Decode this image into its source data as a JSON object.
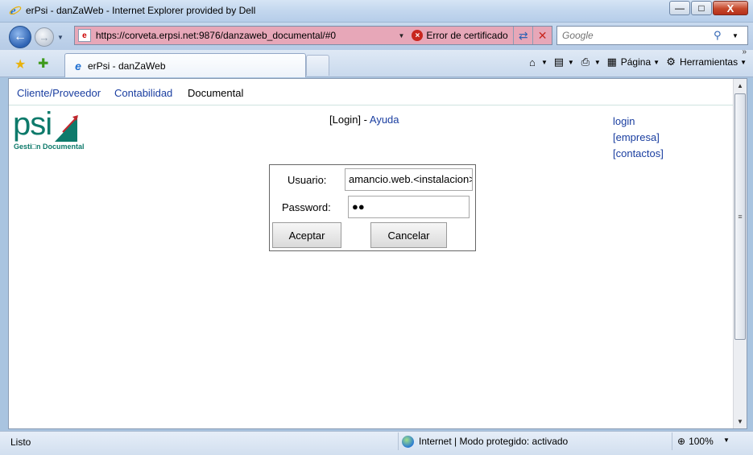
{
  "window": {
    "title": "erPsi - danZaWeb - Internet Explorer provided by Dell",
    "close_glyph": "X",
    "max_glyph": "□",
    "min_glyph": "—"
  },
  "address": {
    "url": "https://corveta.erpsi.net:9876/danzaweb_documental/#0",
    "cert_error": "Error de certificado",
    "search_placeholder": "Google"
  },
  "tabs": {
    "active_label": "erPsi - danZaWeb"
  },
  "commandbar": {
    "page_label": "Página",
    "tools_label": "Herramientas"
  },
  "menu": {
    "items": [
      "Cliente/Proveedor",
      "Contabilidad",
      "Documental"
    ]
  },
  "logo": {
    "text": "psi",
    "subtitle": "Gesti□n Documental"
  },
  "header_links": {
    "login_bracket": "[Login]",
    "separator": " - ",
    "help": "Ayuda"
  },
  "side_links": {
    "items": [
      "login",
      "[empresa]",
      "[contactos]"
    ]
  },
  "login_form": {
    "user_label": "Usuario:",
    "user_value": "amancio.web.<instalacion>",
    "password_label": "Password:",
    "password_value": "●●",
    "accept_label": "Aceptar",
    "cancel_label": "Cancelar"
  },
  "status": {
    "text": "Listo",
    "zone": "Internet | Modo protegido: activado",
    "zoom": "100%"
  },
  "colors": {
    "address_error_bg": "#e7a7b8",
    "link": "#1a3ea0",
    "logo_teal": "#0e7a6b",
    "logo_arrow": "#c0272d"
  }
}
